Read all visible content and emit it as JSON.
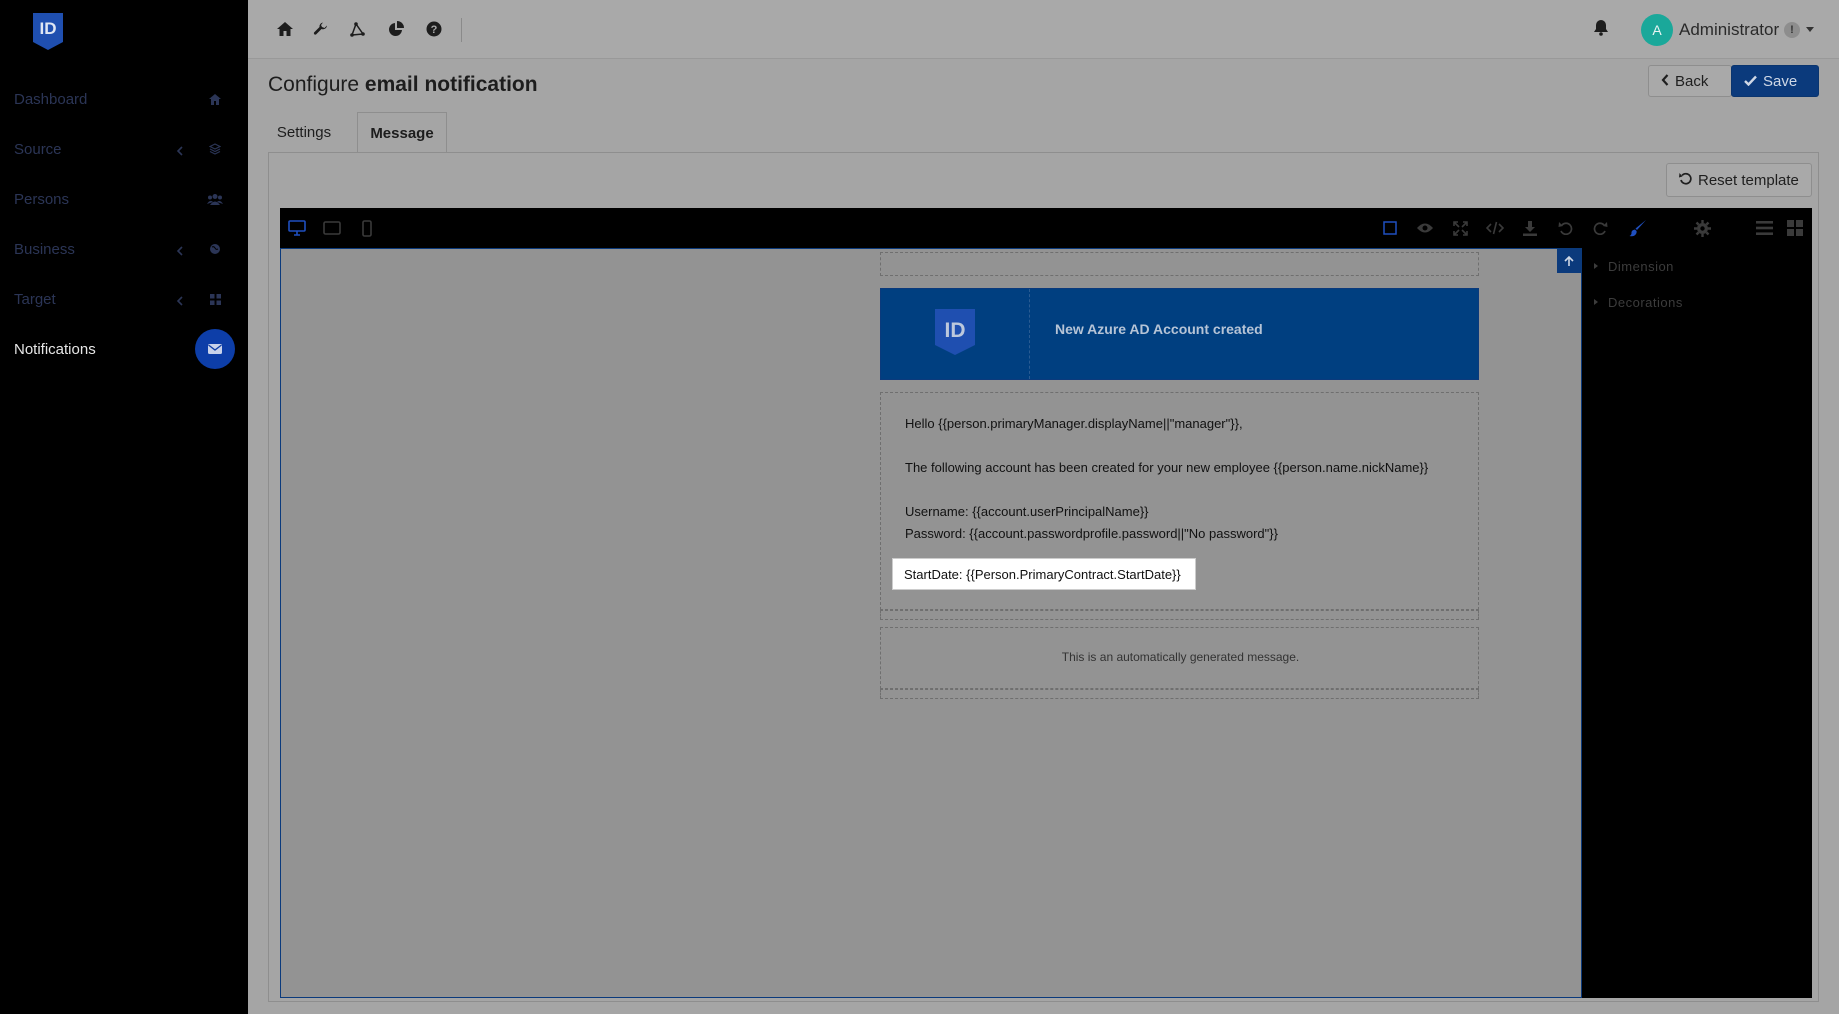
{
  "sidebar": {
    "logo_text": "ID",
    "items": [
      {
        "label": "Dashboard",
        "icon": "home-icon"
      },
      {
        "label": "Source",
        "icon": "layers-icon"
      },
      {
        "label": "Persons",
        "icon": "users-icon"
      },
      {
        "label": "Business",
        "icon": "globe-icon"
      },
      {
        "label": "Target",
        "icon": "grid-icon"
      },
      {
        "label": "Notifications",
        "icon": "envelope-icon"
      }
    ]
  },
  "topbar": {
    "icons": [
      "home-icon",
      "wrench-icon",
      "vector-icon",
      "pie-chart-icon",
      "help-icon"
    ],
    "user": {
      "avatar_initial": "A",
      "name": "Administrator",
      "badge": "!"
    }
  },
  "page": {
    "title_prefix": "Configure",
    "title_bold": "email notification",
    "back_label": "Back",
    "save_label": "Save",
    "tabs": [
      {
        "label": "Settings"
      },
      {
        "label": "Message"
      }
    ],
    "active_tab": "Message",
    "reset_label": "Reset template"
  },
  "editor": {
    "device_icons": [
      "desktop-icon",
      "tablet-icon",
      "mobile-icon"
    ],
    "tool_icons": [
      "square-icon",
      "eye-icon",
      "fullscreen-icon",
      "code-icon",
      "download-icon",
      "undo-icon",
      "redo-icon",
      "brush-icon",
      "settings-icon",
      "layers-icon",
      "blocks-icon"
    ],
    "accent": "#1f4fbf",
    "style_sections": [
      "Dimension",
      "Decorations"
    ]
  },
  "email": {
    "logo_text": "ID",
    "header_title": "New Azure AD Account created",
    "header_color": "#003f80",
    "greeting": "Hello {{person.primaryManager.displayName||\"manager\"}},",
    "intro": "The following account has been created for your new employee {{person.name.nickName}}",
    "username_line": "Username: {{account.userPrincipalName}}",
    "password_line": "Password: {{account.passwordprofile.password||\"No password\"}}",
    "startdate_line": "StartDate: {{Person.PrimaryContract.StartDate}}",
    "footer": "This is an automatically generated message."
  }
}
